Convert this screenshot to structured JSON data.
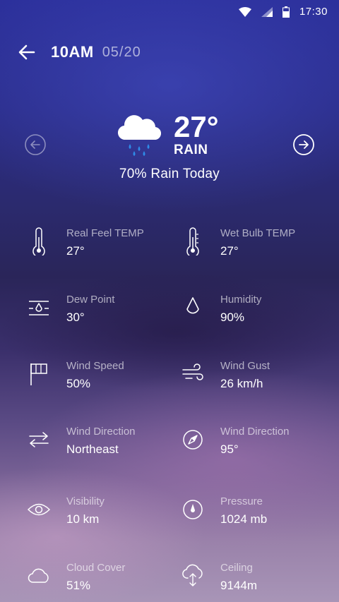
{
  "status_bar": {
    "time": "17:30",
    "icons": [
      "wifi-icon",
      "cell-signal-icon",
      "battery-icon"
    ]
  },
  "header": {
    "time": "10AM",
    "date": "05/20"
  },
  "current": {
    "temperature": "27°",
    "condition": "RAIN",
    "rain_chance": "70% Rain Today",
    "icon": "rain-cloud-icon"
  },
  "details": [
    {
      "label": "Real Feel TEMP",
      "value": "27°",
      "icon": "thermometer-icon"
    },
    {
      "label": "Wet Bulb TEMP",
      "value": "27°",
      "icon": "thermometer-icon"
    },
    {
      "label": "Dew Point",
      "value": "30°",
      "icon": "dew-point-icon"
    },
    {
      "label": "Humidity",
      "value": "90%",
      "icon": "droplet-icon"
    },
    {
      "label": "Wind Speed",
      "value": "50%",
      "icon": "windsock-icon"
    },
    {
      "label": "Wind Gust",
      "value": "26 km/h",
      "icon": "wind-icon"
    },
    {
      "label": "Wind Direction",
      "value": "Northeast",
      "icon": "direction-arrows-icon"
    },
    {
      "label": "Wind Direction",
      "value": "95°",
      "icon": "compass-icon"
    },
    {
      "label": "Visibility",
      "value": "10 km",
      "icon": "eye-icon"
    },
    {
      "label": "Pressure",
      "value": "1024 mb",
      "icon": "pressure-icon"
    },
    {
      "label": "Cloud Cover",
      "value": "51%",
      "icon": "cloud-icon"
    },
    {
      "label": "Ceiling",
      "value": "9144m",
      "icon": "ceiling-icon"
    }
  ]
}
